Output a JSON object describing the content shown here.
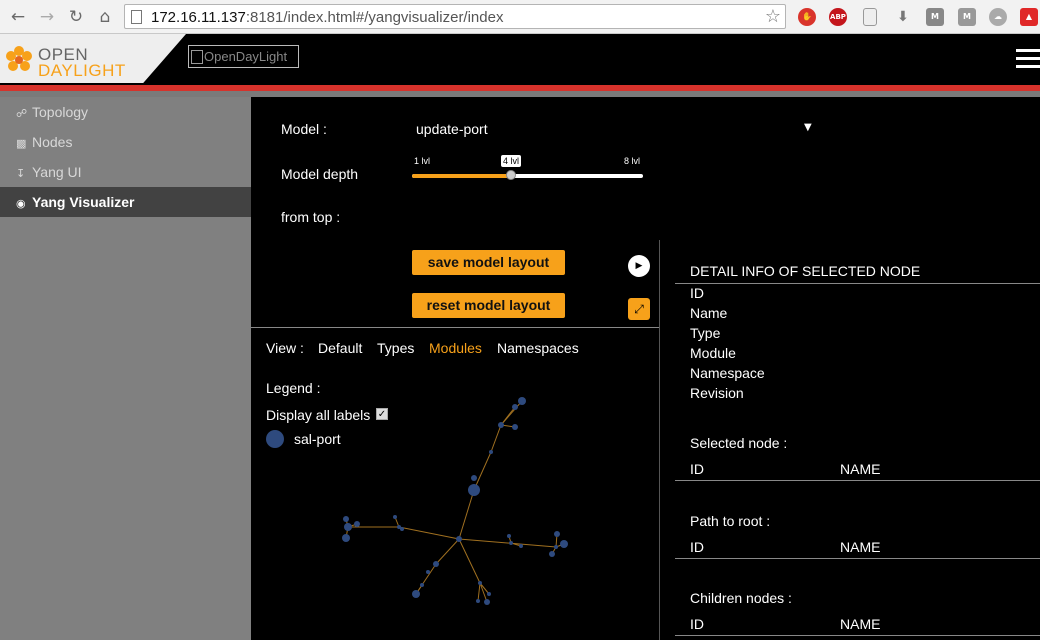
{
  "browser": {
    "url_prefix": "172.16.11.137",
    "url_suffix": ":8181/index.html#/yangvisualizer/index",
    "ext_abp": "ABP"
  },
  "header": {
    "logo_open": "OPEN",
    "logo_daylight": "DAYLIGHT",
    "broken_image_alt": "OpenDayLight"
  },
  "sidebar": {
    "items": [
      {
        "label": "Topology",
        "icon": "share-icon"
      },
      {
        "label": "Nodes",
        "icon": "sitemap-icon"
      },
      {
        "label": "Yang UI",
        "icon": "download-icon"
      },
      {
        "label": "Yang Visualizer",
        "icon": "eye-icon",
        "active": true
      }
    ]
  },
  "form": {
    "model_label": "Model :",
    "model_value": "update-port",
    "depth_label": "Model depth",
    "depth_min_label": "1 lvl",
    "depth_current_label": "4 lvl",
    "depth_max_label": "8 lvl",
    "depth_min": 1,
    "depth_max": 8,
    "depth_value": 4,
    "from_top_label": "from top :",
    "save_button": "save model layout",
    "reset_button": "reset model layout"
  },
  "view": {
    "label": "View :",
    "tabs": [
      "Default",
      "Types",
      "Modules",
      "Namespaces"
    ],
    "active_tab": "Modules",
    "legend_label": "Legend :",
    "display_labels": "Display all labels",
    "display_labels_checked": true,
    "legend_items": [
      {
        "name": "sal-port",
        "color": "#2e4a7e"
      }
    ]
  },
  "detail": {
    "title": "DETAIL INFO OF SELECTED NODE",
    "fields": [
      "ID",
      "Name",
      "Type",
      "Module",
      "Namespace",
      "Revision"
    ],
    "selected_node_label": "Selected node :",
    "path_to_root_label": "Path to root :",
    "children_nodes_label": "Children nodes :",
    "col_id": "ID",
    "col_name": "NAME"
  },
  "colors": {
    "accent": "#f7a11a",
    "header_red": "#d6322b",
    "node": "#2e4a7e",
    "edge": "#a07020"
  }
}
